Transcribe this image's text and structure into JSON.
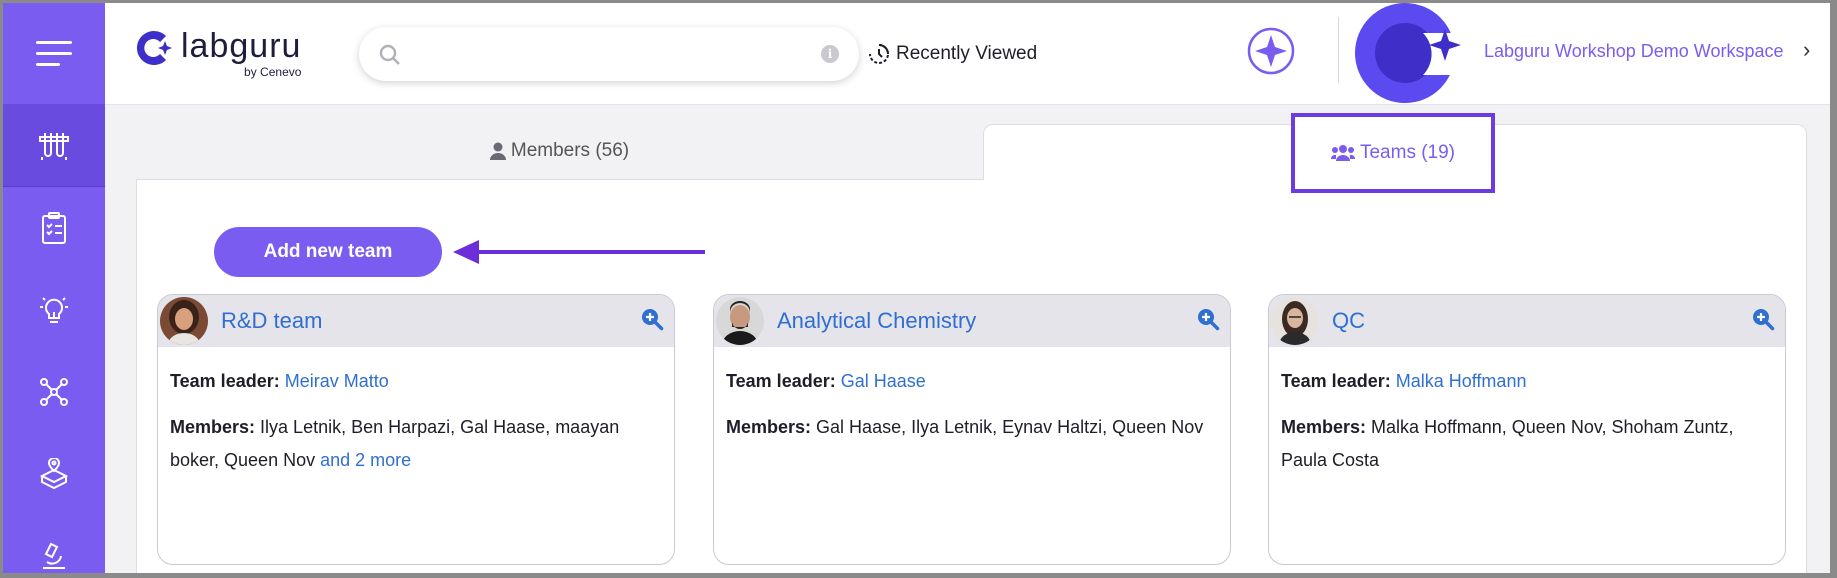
{
  "header": {
    "logo_word": "labguru",
    "logo_by": "by Cenevo",
    "search_placeholder": "",
    "recently_viewed": "Recently Viewed",
    "workspace_name": "Labguru Workshop Demo Workspace",
    "workspace_chevron": "›"
  },
  "sidebar": {
    "items": [
      {
        "icon": "menu-icon"
      },
      {
        "icon": "test-tubes-icon"
      },
      {
        "icon": "clipboard-checklist-icon"
      },
      {
        "icon": "lightbulb-icon"
      },
      {
        "icon": "network-icon"
      },
      {
        "icon": "box-pin-icon"
      },
      {
        "icon": "microscope-icon"
      }
    ]
  },
  "tabs": {
    "members": "Members (56)",
    "teams": "Teams (19)"
  },
  "actions": {
    "add_team": "Add new team"
  },
  "labels": {
    "team_leader": "Team leader:",
    "members": "Members:"
  },
  "teams": [
    {
      "name": "R&D team",
      "leader": "Meirav Matto",
      "members_line": "Ilya Letnik, Ben Harpazi, Gal Haase, maayan boker, Queen Nov",
      "more": "and 2 more"
    },
    {
      "name": "Analytical Chemistry",
      "leader": "Gal Haase",
      "members_line": "Gal Haase, Ilya Letnik, Eynav Haltzi, Queen Nov",
      "more": ""
    },
    {
      "name": "QC",
      "leader": "Malka Hoffmann",
      "members_line": "Malka Hoffmann, Queen Nov, Shoham Zuntz, Paula Costa",
      "more": ""
    }
  ],
  "colors": {
    "brand_purple": "#7b5cf0",
    "link_blue": "#2f6fd1",
    "highlight_border": "#6c3ce0"
  }
}
